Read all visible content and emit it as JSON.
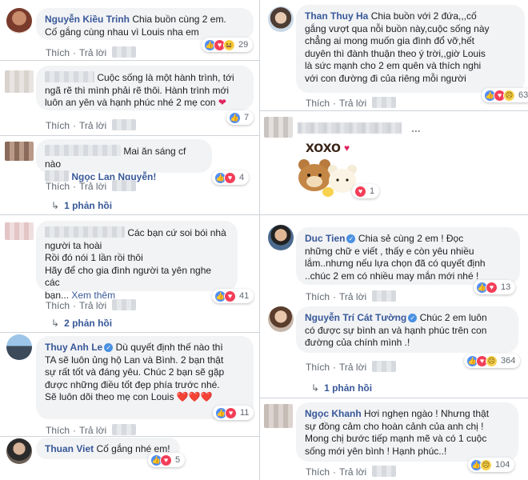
{
  "left": [
    {
      "name": "Nguyễn Kiều Trinh",
      "lines": [
        "Chia buồn cùng 2 em.",
        "Cố gắng cùng nhau vì Louis nha em"
      ],
      "like": "Thích",
      "reply": "Trả lời",
      "reactions": [
        "like",
        "love",
        "haha"
      ],
      "count": "29"
    },
    {
      "name": "",
      "lines": [
        "Cuộc sống là một hành trình, tới",
        "ngã rẽ thì mình phải rẽ thôi. Hành trình mới",
        "luôn an yên và hạnh phúc nhé 2 mẹ con"
      ],
      "heart": "❤",
      "like": "Thích",
      "reply": "Trả lời",
      "reactions": [
        "like"
      ],
      "count": "7"
    },
    {
      "name": "",
      "lines": [
        "Mai ăn sáng cf nào",
        "Ngọc Lan Nguyễn!"
      ],
      "like": "Thích",
      "reply": "Trả lời",
      "reactions": [
        "like",
        "love"
      ],
      "count": "4",
      "replies": "1 phản hồi"
    },
    {
      "name": "",
      "lines": [
        "Các bạn cứ soi bói nhà",
        "người ta hoài",
        "Rồi đó nói 1 lần rồi thôi",
        "Hãy để cho gia đình người ta yên nghe các",
        "bạn..."
      ],
      "more": "Xem thêm",
      "like": "Thích",
      "reply": "Trả lời",
      "reactions": [
        "like",
        "love"
      ],
      "count": "41",
      "replies": "2 phản hồi"
    },
    {
      "name": "Thuy Anh Le",
      "lines": [
        "Dù quyết định thế nào thì",
        "TA sẽ luôn ủng hộ Lan và Bình. 2 bạn thật",
        "sự rất tốt và đáng yêu. Chúc 2 bạn sẽ gặp",
        "được những điều tốt đẹp phía trước nhé.",
        "Sẽ luôn dõi theo mẹ con Louis"
      ],
      "hearts": "❤️❤️❤️",
      "like": "Thích",
      "reply": "Trả lời",
      "reactions": [
        "like",
        "love"
      ],
      "count": "11"
    },
    {
      "name": "Thuan Viet",
      "lines": [
        "Cố gắng nhé em!"
      ],
      "reactions": [
        "like",
        "love"
      ],
      "count": "5"
    }
  ],
  "right": [
    {
      "name": "Than Thuy Ha",
      "lines": [
        "Chia buồn với 2 đứa,,,cố",
        "gắng vượt qua nỗi buồn này,cuộc sống này",
        "chẳng ai mong muốn gia đình đổ vỡ,hết",
        "duyên thì đành thuận theo ý trời,,giờ Louis",
        "là sức mạnh cho 2 em quên và thích nghi",
        "với con đường đi của riêng mỗi người"
      ],
      "like": "Thích",
      "reply": "Trả lời",
      "reactions": [
        "like",
        "love",
        "sad"
      ],
      "count": "63"
    },
    {
      "name": "",
      "sticker": "XOXO",
      "reactions": [
        "love"
      ],
      "count": "1",
      "more_dots": "..."
    },
    {
      "name": "Duc Tien",
      "lines": [
        "Chia sẻ cùng 2 em ! Đọc",
        "những chữ e viết , thấy e còn yêu nhiều",
        "lắm..nhưng nếu lựa chọn đã có quyết định",
        "..chúc 2 em có nhiều may mắn mới nhé !"
      ],
      "like": "Thích",
      "reply": "Trả lời",
      "reactions": [
        "like",
        "love"
      ],
      "count": "13"
    },
    {
      "name": "Nguyễn Trí Cát Tường",
      "lines": [
        "Chúc 2 em luôn",
        "có được sự bình an và hạnh phúc trên con",
        "đường của chính mình .!"
      ],
      "like": "Thích",
      "reply": "Trả lời",
      "reactions": [
        "like",
        "love",
        "sad"
      ],
      "count": "364",
      "replies": "1 phản hồi"
    },
    {
      "name": "Ngọc Khanh",
      "lines": [
        "Hơi nghẹn ngào ! Nhưng thật",
        "sự đồng cảm cho hoàn cảnh của anh chị !",
        "Mong chị bước tiếp mạnh mẽ và có 1 cuộc",
        "sống mới yên bình ! Hạnh phúc..!"
      ],
      "like": "Thích",
      "reply": "Trả lời",
      "reactions": [
        "like",
        "sad"
      ],
      "count": "104"
    }
  ]
}
